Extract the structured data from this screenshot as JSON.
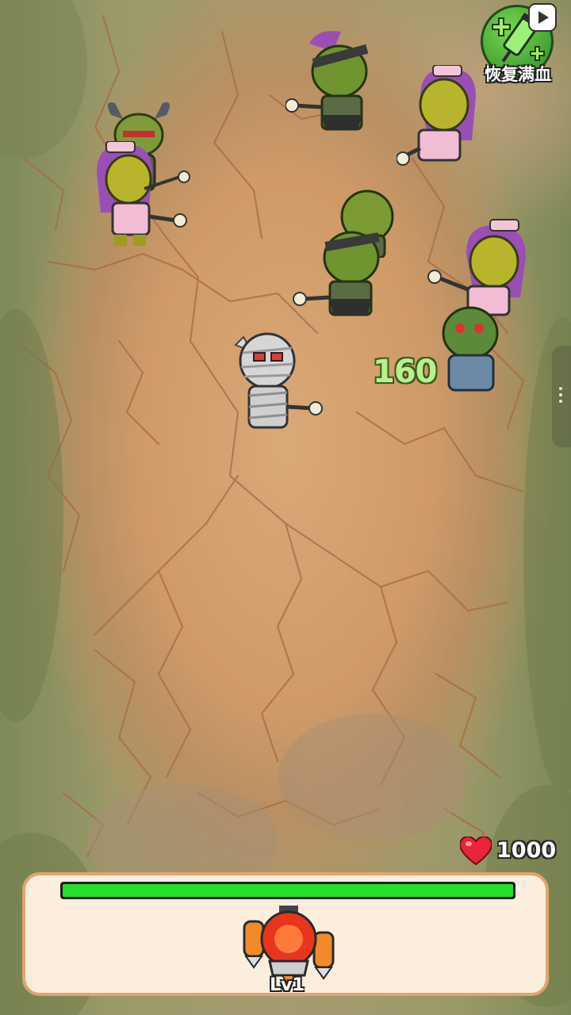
{
  "hud": {
    "heal_button": {
      "label": "恢复满血",
      "icon": "syringe-icon",
      "badge_icon": "video-ad-icon"
    },
    "damage_popup": "160",
    "player_hp": {
      "value": "1000",
      "icon": "heart-icon"
    },
    "health_bar": {
      "fill_fraction": 1.0,
      "color": "#22e02b"
    },
    "weapon": {
      "icon": "jetpack-turret-icon",
      "level": "Lv1"
    }
  },
  "characters": {
    "hero": "mummy",
    "enemies": [
      "horned-orc",
      "nurse-zombie",
      "ninja-orc",
      "nurse-zombie",
      "orc",
      "ninja-orc",
      "nurse-zombie",
      "zombie"
    ]
  },
  "colors": {
    "ground": "#d0a06e",
    "panel_bg": "#fbeedd",
    "panel_border": "#e3a36e",
    "damage_text": "#b8f08c",
    "heart": "#e8253a"
  }
}
